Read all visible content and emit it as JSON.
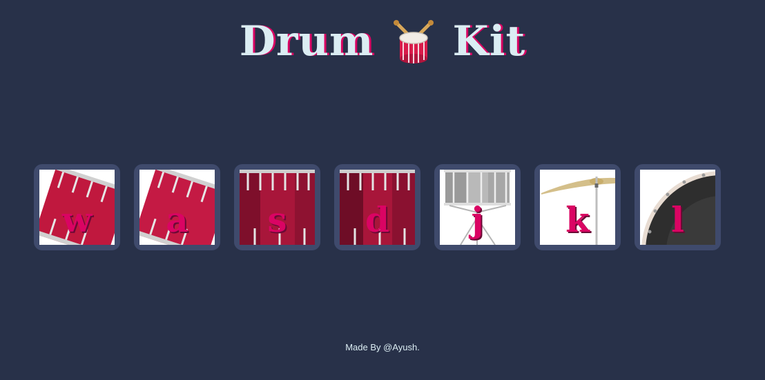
{
  "title": {
    "left_word": "Drum",
    "right_word": "Kit",
    "icon": "drum-emoji"
  },
  "drums": [
    {
      "key": "w",
      "art": "tom-tom-tilted"
    },
    {
      "key": "a",
      "art": "tom-tom-tilted"
    },
    {
      "key": "s",
      "art": "bass-drum-red"
    },
    {
      "key": "d",
      "art": "bass-drum-red"
    },
    {
      "key": "j",
      "art": "snare-drum"
    },
    {
      "key": "k",
      "art": "crash-cymbal"
    },
    {
      "key": "l",
      "art": "kick-drum"
    }
  ],
  "footer": {
    "text": "Made By @Ayush."
  },
  "colors": {
    "background": "#283149",
    "tile_frame": "#3f4a6c",
    "accent": "#DA0463",
    "title_text": "#DBEDF3"
  }
}
